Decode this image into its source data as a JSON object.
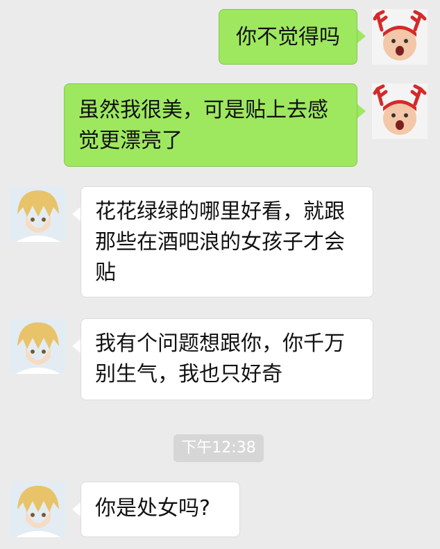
{
  "messages": [
    {
      "side": "me",
      "text": "你不觉得吗"
    },
    {
      "side": "me",
      "text": "虽然我很美，可是贴上去感觉更漂亮了"
    },
    {
      "side": "other",
      "text": "花花绿绿的哪里好看，就跟那些在酒吧浪的女孩子才会贴"
    },
    {
      "side": "other",
      "text": "我有个问题想跟你，你千万别生气，我也只好奇"
    },
    {
      "side": "other",
      "text": "你是处女吗?"
    }
  ],
  "timestamp": "下午12:38",
  "avatars": {
    "me": "baby-with-reindeer-antlers-avatar",
    "other": "anime-blond-boy-avatar"
  },
  "colors": {
    "background": "#ebebeb",
    "my_bubble": "#9ee85f",
    "their_bubble": "#ffffff",
    "timestamp_bg": "#d6d6d6"
  }
}
